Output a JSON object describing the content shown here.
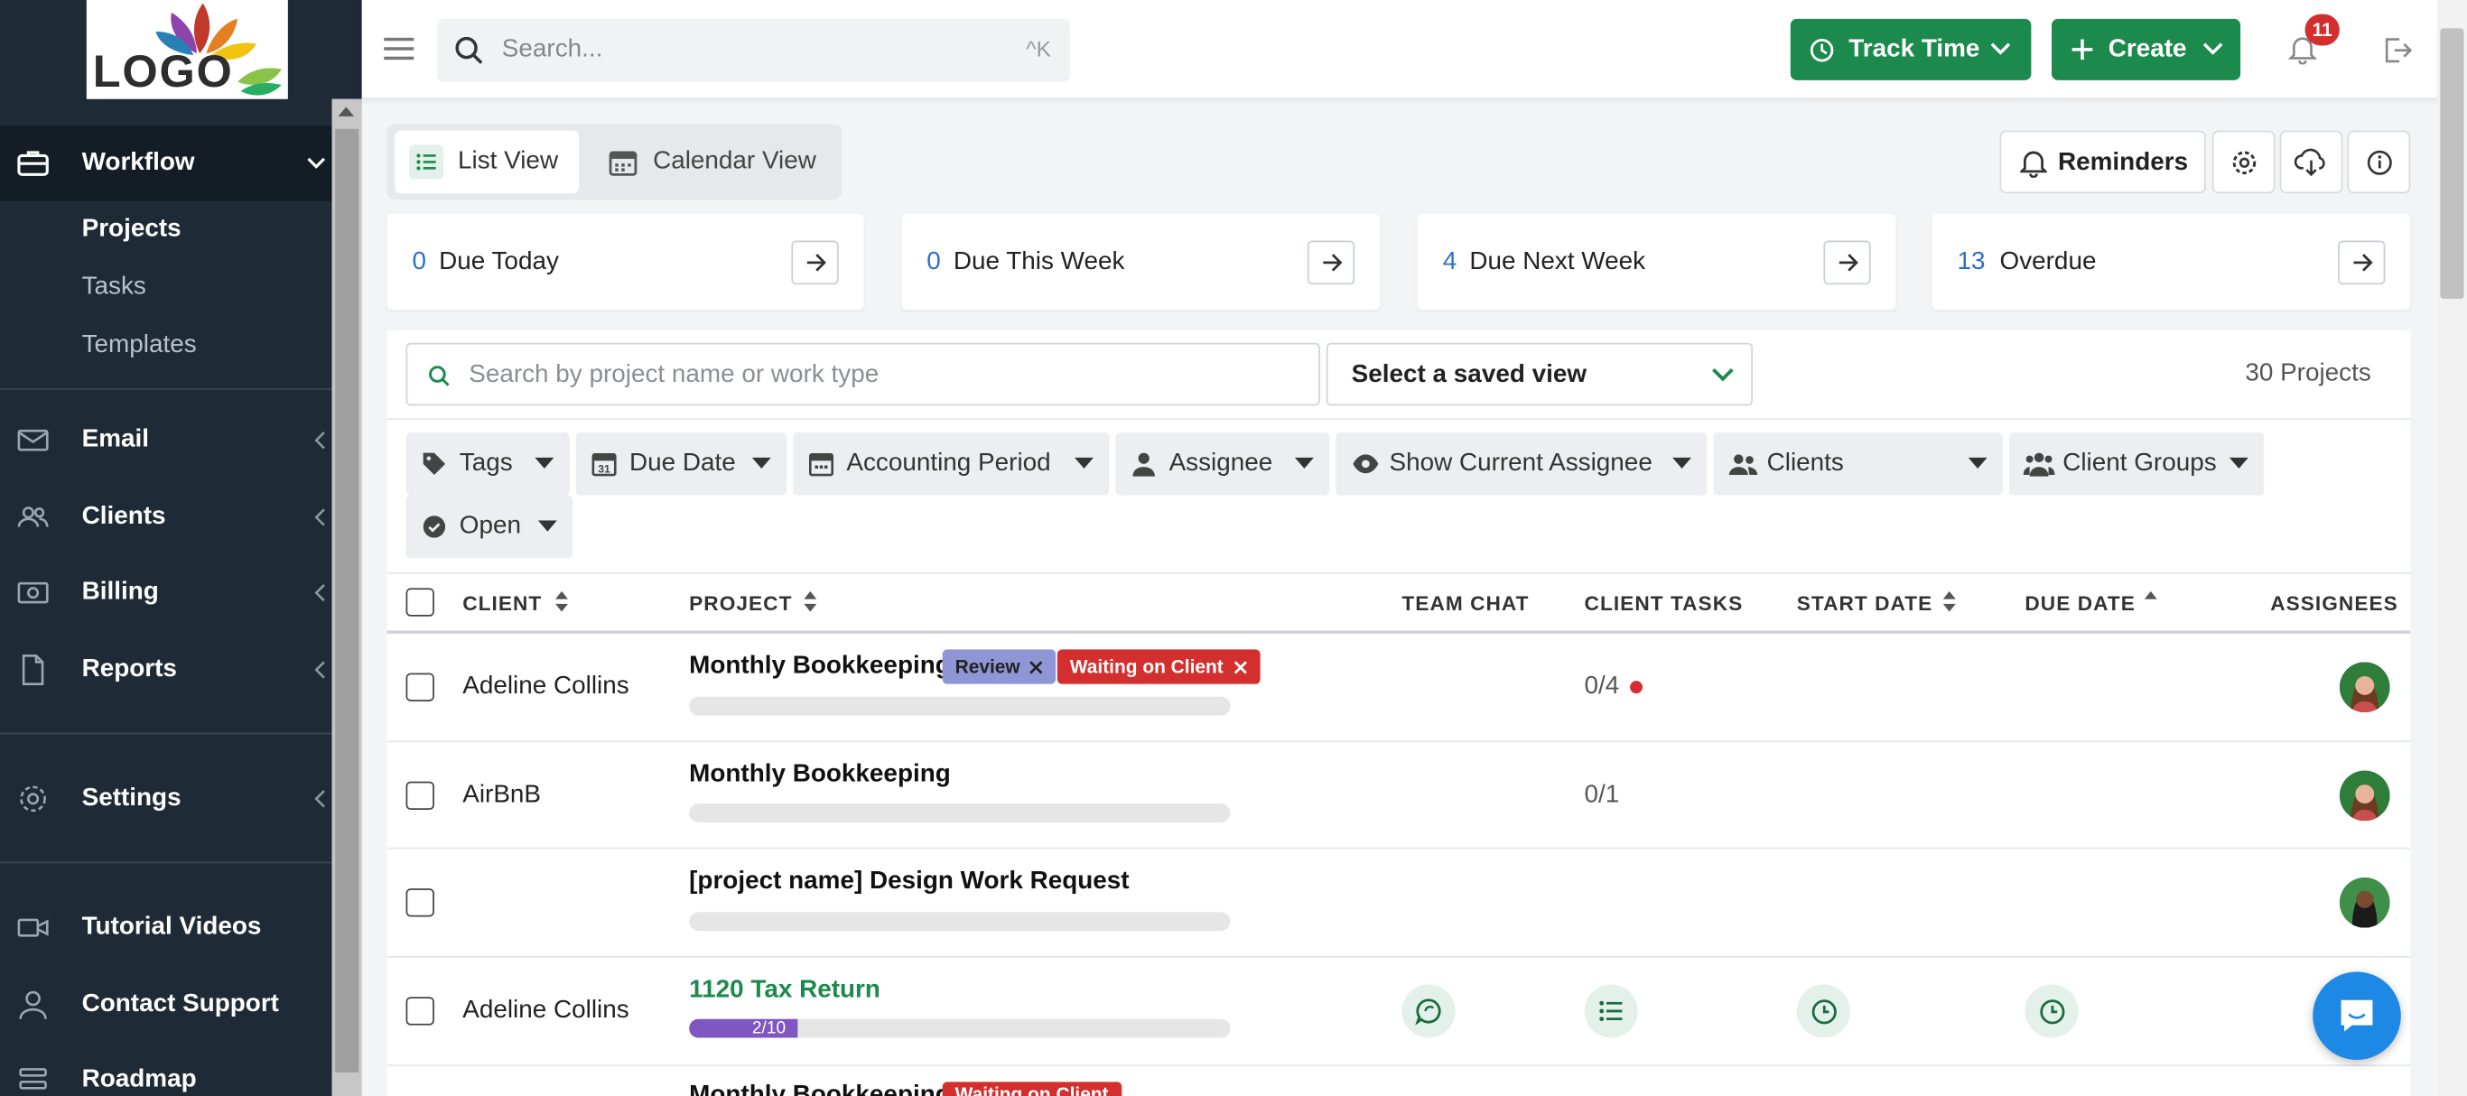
{
  "brand": {
    "logo_text": "LOGO",
    "accent": "#1b8a4c",
    "sidebar_bg": "#1e2a35"
  },
  "topbar": {
    "search_placeholder": "Search...",
    "search_shortcut": "^K",
    "track_time": "Track Time",
    "create": "Create",
    "notification_count": "11"
  },
  "sidebar": {
    "workflow": "Workflow",
    "sub_items": [
      "Projects",
      "Tasks",
      "Templates"
    ],
    "email": "Email",
    "clients": "Clients",
    "billing": "Billing",
    "reports": "Reports",
    "settings": "Settings",
    "tutorial_videos": "Tutorial Videos",
    "contact_support": "Contact Support",
    "roadmap": "Roadmap"
  },
  "views": {
    "list": "List View",
    "calendar": "Calendar View",
    "reminders": "Reminders"
  },
  "summary": [
    {
      "count": "0",
      "label": "Due Today"
    },
    {
      "count": "0",
      "label": "Due This Week"
    },
    {
      "count": "4",
      "label": "Due Next Week"
    },
    {
      "count": "13",
      "label": "Overdue"
    }
  ],
  "filters": {
    "search_placeholder": "Search by project name or work type",
    "saved_view": "Select a saved view",
    "project_count": "30 Projects",
    "chips": [
      "Tags",
      "Due Date",
      "Accounting Period",
      "Assignee",
      "Show Current Assignee",
      "Clients",
      "Client Groups",
      "Open"
    ]
  },
  "table": {
    "headers": {
      "client": "CLIENT",
      "project": "PROJECT",
      "team_chat": "TEAM CHAT",
      "client_tasks": "CLIENT TASKS",
      "start_date": "START DATE",
      "due_date": "DUE DATE",
      "assignees": "ASSIGNEES"
    },
    "rows": [
      {
        "client": "Adeline Collins",
        "project": "Monthly Bookkeeping",
        "tags": [
          "Review",
          "Waiting on Client"
        ],
        "client_tasks": "0/4"
      },
      {
        "client": "AirBnB",
        "project": "Monthly Bookkeeping",
        "client_tasks": "0/1"
      },
      {
        "client": "",
        "project": "[project name] Design Work Request"
      },
      {
        "client": "Adeline Collins",
        "project": "1120 Tax Return",
        "progress_label": "2/10",
        "progress": 0.2
      },
      {
        "project": "Monthly Bookkeeping",
        "tag": "Waiting on Client"
      }
    ]
  }
}
